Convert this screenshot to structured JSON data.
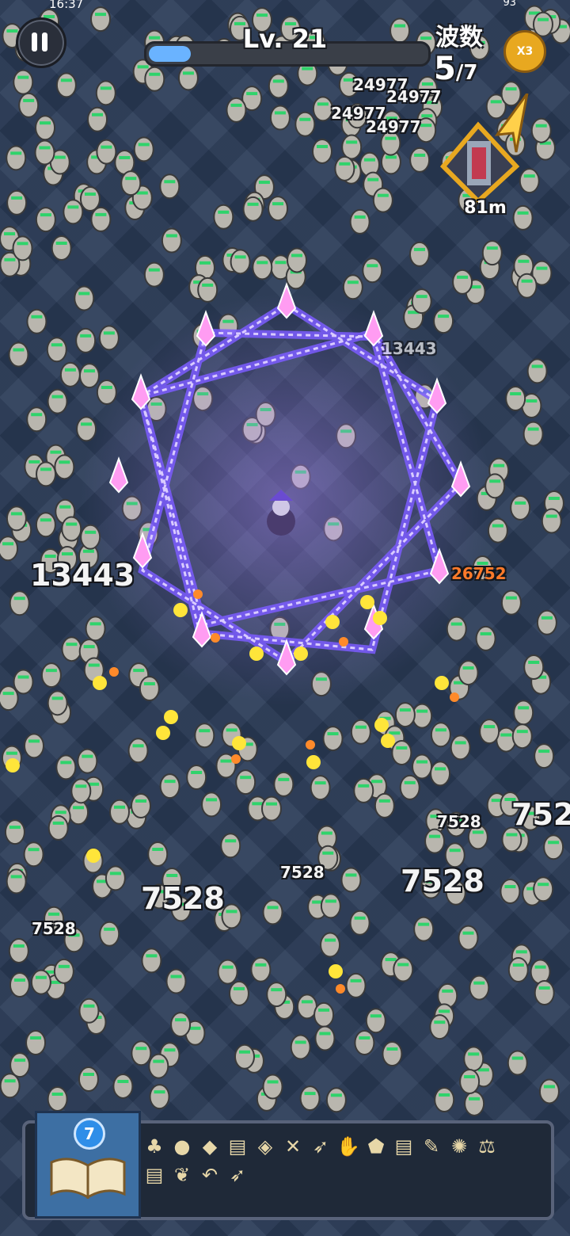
{
  "status_bar": {
    "time": "16:37",
    "battery": "93"
  },
  "hud": {
    "level_label": "Lv. 21",
    "xp_progress": 0.15,
    "wave_title": "波数",
    "wave_current": "5",
    "wave_total": "/7",
    "speed_label": "X3",
    "portal_distance": "81m"
  },
  "damage_numbers": [
    "24977",
    "24977",
    "24977",
    "24977",
    "13443",
    "13443",
    "26752",
    "7528",
    "7528",
    "7528",
    "7528",
    "7528",
    "752"
  ],
  "skill_panel": {
    "book_level": "7",
    "icons": [
      "mushroom-icon",
      "frog-icon",
      "bat-icon",
      "scroll-icon",
      "shield-gem-icon",
      "crossed-swords-icon",
      "wing-icon",
      "glove-icon",
      "blue-shield-icon",
      "scroll-icon",
      "feather-icon",
      "sun-icon",
      "scales-icon",
      "scroll-icon",
      "leaf-icon",
      "boomerang-icon",
      "wing-icon"
    ]
  },
  "colors": {
    "xp_fill": "#6ab3ff",
    "magic_chain": "#6f4dff",
    "crystal": "#ff9cf2",
    "speed_button": "#e8a820"
  }
}
